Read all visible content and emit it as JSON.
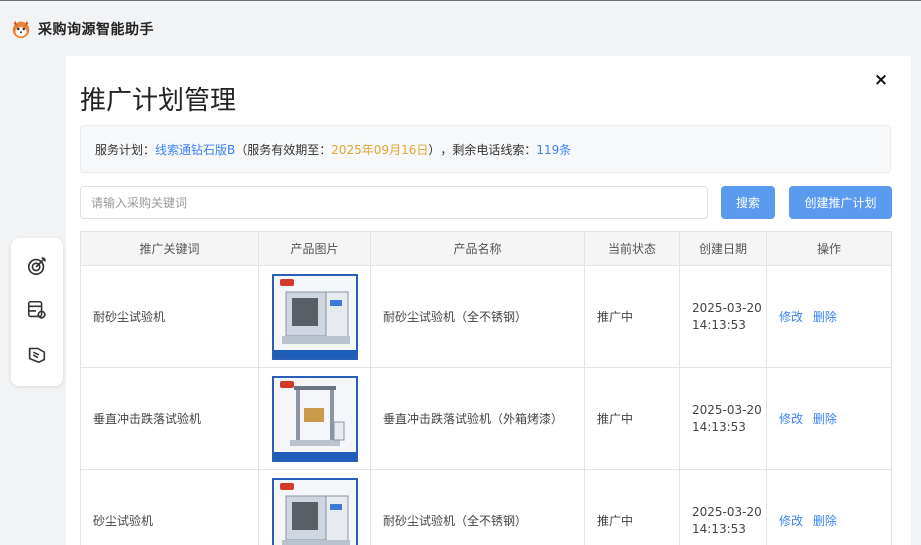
{
  "app": {
    "title": "采购询源智能助手"
  },
  "page": {
    "title": "推广计划管理",
    "close_label": "×"
  },
  "plan": {
    "label": "服务计划：",
    "name": "线索通钻石版B",
    "validity_prefix": "（服务有效期至：",
    "validity_date": "2025年09月16日",
    "validity_suffix": "）",
    "remaining_label": "，剩余电话线索：",
    "remaining_count": "119条"
  },
  "search": {
    "placeholder": "请输入采购关键词",
    "value": "",
    "button_label": "搜索"
  },
  "create_button_label": "创建推广计划",
  "table": {
    "headers": [
      "推广关键词",
      "产品图片",
      "产品名称",
      "当前状态",
      "创建日期",
      "操作"
    ],
    "rows": [
      {
        "keyword": "耐砂尘试验机",
        "product_name": "耐砂尘试验机（全不锈钢）",
        "status": "推广中",
        "date": "2025-03-20",
        "time": "14:13:53",
        "edit": "修改",
        "delete": "删除"
      },
      {
        "keyword": "垂直冲击跌落试验机",
        "product_name": "垂直冲击跌落试验机（外箱烤漆）",
        "status": "推广中",
        "date": "2025-03-20",
        "time": "14:13:53",
        "edit": "修改",
        "delete": "删除"
      },
      {
        "keyword": "砂尘试验机",
        "product_name": "耐砂尘试验机（全不锈钢）",
        "status": "推广中",
        "date": "2025-03-20",
        "time": "14:13:53",
        "edit": "修改",
        "delete": "删除"
      }
    ]
  },
  "icons": {
    "rail": [
      "target-icon",
      "settings-database-icon",
      "handshake-icon"
    ],
    "status_color": "#3da34a",
    "link_color": "#3b82f6",
    "accent_color": "#5b9bef",
    "date_color": "#e0a534"
  }
}
